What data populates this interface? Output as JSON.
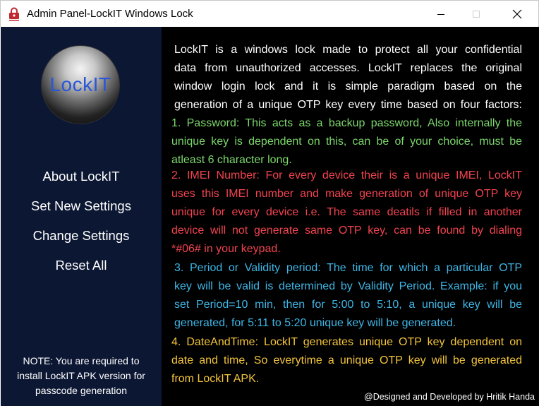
{
  "window": {
    "title": "Admin Panel-LockIT Windows Lock",
    "icon": "lock-app-icon"
  },
  "sidebar": {
    "logo_text": "LockIT",
    "nav": [
      {
        "label": "About LockIT"
      },
      {
        "label": "Set New Settings"
      },
      {
        "label": "Change Settings"
      },
      {
        "label": "Reset All"
      }
    ],
    "note_lines": [
      "NOTE: You are required to",
      "install LockIT APK version for",
      "passcode generation"
    ]
  },
  "content": {
    "intro": [
      "LockIT is a windows lock made to protect all your confidential",
      "data from unauthorized accesses. LockIT replaces the original",
      "window login lock and it is simple paradigm based on the",
      "generation of a unique OTP key every time based on four factors:"
    ],
    "password": [
      "1. Password: This acts as a backup password, Also internally the",
      "unique key is dependent on this, can be of your choice, must be",
      "atleast 6 character long."
    ],
    "imei": [
      "2. IMEI Number: For every device their is a unique IMEI, LockIT",
      "uses this IMEI number and make generation of unique OTP key",
      "unique for every device i.e. The same deatils if filled in another",
      "device will not generate same OTP key, can be found by dialing",
      "*#06# in your keypad."
    ],
    "period": [
      "3. Period or Validity period: The time for which a particular OTP",
      "key will be valid is determined by  Validity Period.  Example: if you",
      "set Period=10 min, then for 5:00 to 5:10, a unique key will be",
      "generated, for 5:11 to 5:20 unique key will be generated."
    ],
    "datetime": [
      "4. DateAndTime: LockIT generates unique OTP key dependent on",
      "date and time, So everytime a unique OTP key will be generated",
      "from LockIT APK."
    ],
    "credit": "@Designed and Developed by Hritik Handa"
  },
  "colors": {
    "sidebar_bg": "#0c1733",
    "content_bg": "#000000",
    "intro": "#ffffff",
    "password": "#7bd66b",
    "imei": "#f2434f",
    "period": "#3fb6e6",
    "datetime": "#f3c43b",
    "logo_text": "#2a56d8"
  }
}
